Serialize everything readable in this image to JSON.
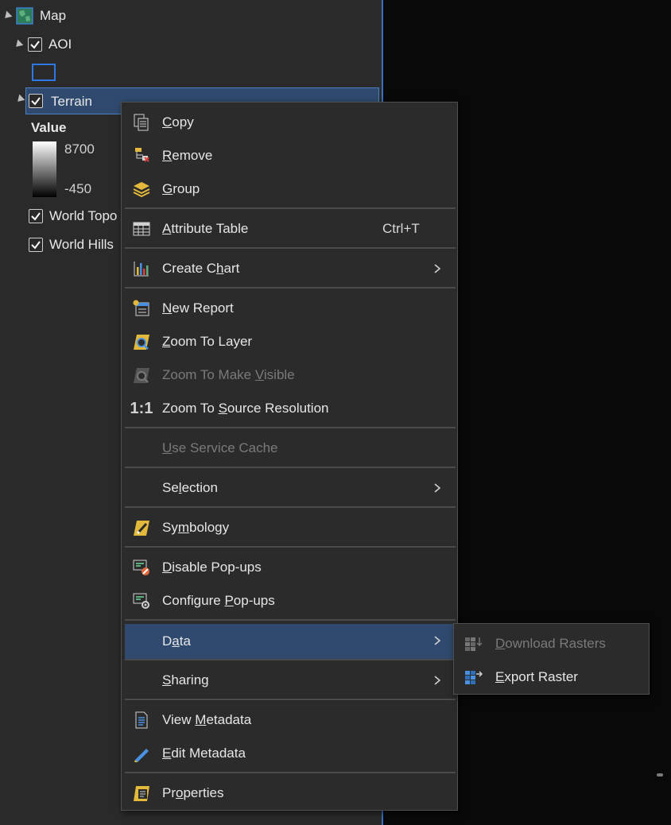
{
  "toc": {
    "map_label": "Map",
    "layers": [
      {
        "label": "AOI",
        "checked": true
      },
      {
        "label": "Terrain",
        "checked": true,
        "selected": true
      },
      {
        "label": "World Topo",
        "checked": true
      },
      {
        "label": "World Hills",
        "checked": true
      }
    ],
    "legend": {
      "title": "Value",
      "high": "8700",
      "low": "-450"
    }
  },
  "context_menu": {
    "items": [
      {
        "label": "Copy",
        "icon": "copy-icon"
      },
      {
        "label": "Remove",
        "icon": "remove-layer-icon"
      },
      {
        "label": "Group",
        "icon": "group-layers-icon"
      },
      {
        "label": "Attribute Table",
        "icon": "attribute-table-icon",
        "shortcut": "Ctrl+T"
      },
      {
        "label": "Create Chart",
        "icon": "chart-icon",
        "submenu": true
      },
      {
        "label": "New Report",
        "icon": "new-report-icon"
      },
      {
        "label": "Zoom To Layer",
        "icon": "zoom-to-layer-icon"
      },
      {
        "label": "Zoom To Make Visible",
        "icon": "zoom-make-visible-icon",
        "disabled": true
      },
      {
        "label": "Zoom To Source Resolution",
        "icon": "one-to-one-icon",
        "icon_text": "1:1"
      },
      {
        "label": "Use Service Cache",
        "disabled": true
      },
      {
        "label": "Selection",
        "submenu": true
      },
      {
        "label": "Symbology",
        "icon": "symbology-icon"
      },
      {
        "label": "Disable Pop-ups",
        "icon": "disable-popups-icon"
      },
      {
        "label": "Configure Pop-ups",
        "icon": "configure-popups-icon"
      },
      {
        "label": "Data",
        "submenu": true,
        "active": true
      },
      {
        "label": "Sharing",
        "submenu": true
      },
      {
        "label": "View Metadata",
        "icon": "view-metadata-icon"
      },
      {
        "label": "Edit Metadata",
        "icon": "edit-metadata-icon"
      },
      {
        "label": "Properties",
        "icon": "properties-icon"
      }
    ]
  },
  "data_submenu": {
    "items": [
      {
        "label": "Download Rasters",
        "icon": "download-rasters-icon",
        "disabled": true
      },
      {
        "label": "Export Raster",
        "icon": "export-raster-icon"
      }
    ]
  },
  "colors": {
    "accent": "#2f4a6e",
    "menu_bg": "#2b2b2b",
    "panel_bg": "#2a2a2a",
    "disabled_text": "#7a7a7a"
  }
}
